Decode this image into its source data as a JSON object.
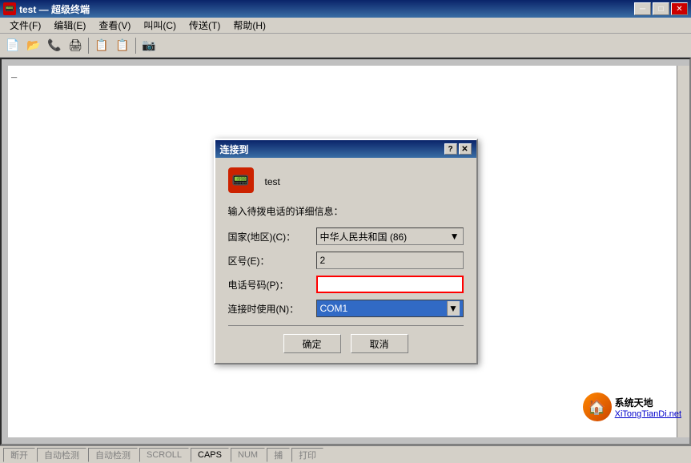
{
  "window": {
    "title": "test — 超级终端",
    "min_btn": "─",
    "max_btn": "□",
    "close_btn": "✕"
  },
  "menubar": {
    "items": [
      {
        "label": "文件(F)"
      },
      {
        "label": "编辑(E)"
      },
      {
        "label": "查看(V)"
      },
      {
        "label": "叫叫(C)"
      },
      {
        "label": "传送(T)"
      },
      {
        "label": "帮助(H)"
      }
    ]
  },
  "toolbar": {
    "buttons": [
      "📄",
      "📂",
      "📞",
      "🖨",
      "📋",
      "📋",
      "📷"
    ]
  },
  "dialog": {
    "title": "连接到",
    "help_btn": "?",
    "close_btn": "✕",
    "connection_name": "test",
    "description": "输入待拨电话的详细信息：",
    "fields": {
      "country_label": "国家(地区)(C)：",
      "country_value": "中华人民共和国 (86)",
      "area_label": "区号(E)：",
      "area_value": "2",
      "phone_label": "电话号码(P)：",
      "phone_value": "",
      "connect_label": "连接时使用(N)：",
      "connect_value": "COM1"
    },
    "ok_btn": "确定",
    "cancel_btn": "取消"
  },
  "statusbar": {
    "items": [
      {
        "label": "断开",
        "active": false
      },
      {
        "label": "自动检测",
        "active": false
      },
      {
        "label": "自动检测",
        "active": false
      },
      {
        "label": "SCROLL",
        "active": false
      },
      {
        "label": "CAPS",
        "active": true
      },
      {
        "label": "NUM",
        "active": false
      },
      {
        "label": "捕",
        "active": false
      },
      {
        "label": "打印",
        "active": false
      }
    ]
  },
  "watermark": {
    "site": "XiTongTianDi.net"
  }
}
